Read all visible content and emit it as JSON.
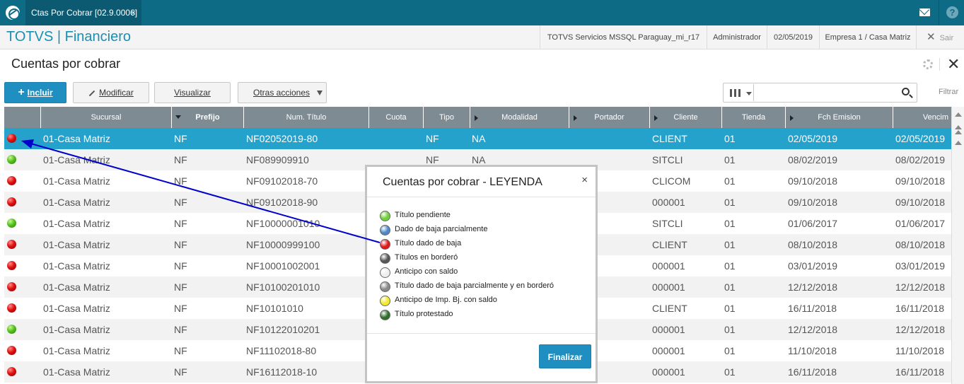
{
  "tab": {
    "title": "Ctas Por Cobrar [02.9.0006]",
    "close": "×"
  },
  "app": {
    "title": "TOTVS | Financiero",
    "server": "TOTVS Servicios MSSQL Paraguay_mi_r17",
    "user": "Administrador",
    "date": "02/05/2019",
    "company": "Empresa 1 / Casa Matriz",
    "exit": "Sair"
  },
  "page": {
    "title": "Cuentas por cobrar"
  },
  "toolbar": {
    "incluir": "Incluir",
    "modificar": "Modificar",
    "visualizar": "Visualizar",
    "otras": "Otras acciones",
    "search_placeholder": "",
    "filtrar": "Filtrar"
  },
  "grid": {
    "headers": [
      "Sucursal",
      "Prefijo",
      "Num. Título",
      "Cuota",
      "Tipo",
      "Modalidad",
      "Portador",
      "Cliente",
      "Tienda",
      "Fch Emision",
      "Vencim"
    ],
    "rows": [
      {
        "status": "red",
        "sucursal": "01-Casa Matriz",
        "prefijo": "NF",
        "num": "NF02052019-80",
        "tipo": "NF",
        "modalidad": "NA",
        "cliente": "CLIENT",
        "tienda": "01",
        "emision": "02/05/2019",
        "venc": "02/05/2019"
      },
      {
        "status": "green",
        "sucursal": "01-Casa Matriz",
        "prefijo": "NF",
        "num": "NF089909910",
        "tipo": "NF",
        "modalidad": "NA",
        "cliente": "SITCLI",
        "tienda": "01",
        "emision": "08/02/2019",
        "venc": "08/02/2019"
      },
      {
        "status": "red",
        "sucursal": "01-Casa Matriz",
        "prefijo": "NF",
        "num": "NF09102018-70",
        "tipo": "",
        "modalidad": "",
        "cliente": "CLICOM",
        "tienda": "01",
        "emision": "09/10/2018",
        "venc": "09/10/2018"
      },
      {
        "status": "red",
        "sucursal": "01-Casa Matriz",
        "prefijo": "NF",
        "num": "NF09102018-90",
        "tipo": "",
        "modalidad": "",
        "cliente": "000001",
        "tienda": "01",
        "emision": "09/10/2018",
        "venc": "09/10/2018"
      },
      {
        "status": "green",
        "sucursal": "01-Casa Matriz",
        "prefijo": "NF",
        "num": "NF10000001010",
        "tipo": "",
        "modalidad": "",
        "cliente": "SITCLI",
        "tienda": "01",
        "emision": "01/06/2017",
        "venc": "01/06/2017"
      },
      {
        "status": "red",
        "sucursal": "01-Casa Matriz",
        "prefijo": "NF",
        "num": "NF10000999100",
        "tipo": "",
        "modalidad": "",
        "cliente": "CLIENT",
        "tienda": "01",
        "emision": "08/10/2018",
        "venc": "08/10/2018"
      },
      {
        "status": "red",
        "sucursal": "01-Casa Matriz",
        "prefijo": "NF",
        "num": "NF10001002001",
        "tipo": "",
        "modalidad": "",
        "cliente": "000001",
        "tienda": "01",
        "emision": "03/01/2019",
        "venc": "03/01/2019"
      },
      {
        "status": "red",
        "sucursal": "01-Casa Matriz",
        "prefijo": "NF",
        "num": "NF10100201010",
        "tipo": "",
        "modalidad": "",
        "cliente": "000001",
        "tienda": "01",
        "emision": "12/12/2018",
        "venc": "12/12/2018"
      },
      {
        "status": "red",
        "sucursal": "01-Casa Matriz",
        "prefijo": "NF",
        "num": "NF10101010",
        "tipo": "",
        "modalidad": "",
        "cliente": "CLIENT",
        "tienda": "01",
        "emision": "16/11/2018",
        "venc": "16/11/2018"
      },
      {
        "status": "green",
        "sucursal": "01-Casa Matriz",
        "prefijo": "NF",
        "num": "NF10122010201",
        "tipo": "",
        "modalidad": "",
        "cliente": "000001",
        "tienda": "01",
        "emision": "12/12/2018",
        "venc": "12/12/2018"
      },
      {
        "status": "red",
        "sucursal": "01-Casa Matriz",
        "prefijo": "NF",
        "num": "NF11102018-80",
        "tipo": "",
        "modalidad": "",
        "cliente": "000001",
        "tienda": "01",
        "emision": "11/10/2018",
        "venc": "11/10/2018"
      },
      {
        "status": "red",
        "sucursal": "01-Casa Matriz",
        "prefijo": "NF",
        "num": "NF16112018-10",
        "tipo": "",
        "modalidad": "",
        "cliente": "000001",
        "tienda": "01",
        "emision": "16/11/2018",
        "venc": "16/11/2018"
      }
    ]
  },
  "legend": {
    "title": "Cuentas por cobrar - LEYENDA",
    "close": "×",
    "items": [
      {
        "label": "Título pendiente",
        "color": "#6fd13a"
      },
      {
        "label": "Dado de baja parcialmente",
        "color": "#4f86c6"
      },
      {
        "label": "Título dado de baja",
        "color": "#e01818"
      },
      {
        "label": "Títulos en borderó",
        "color": "#555555"
      },
      {
        "label": "Anticipo con saldo",
        "color": "#eeeeee"
      },
      {
        "label": "Título dado de baja parcialmente y en borderó",
        "color": "#888888"
      },
      {
        "label": "Anticipo de Imp. Bj. con saldo",
        "color": "#f2ea2a"
      },
      {
        "label": "Título protestado",
        "color": "#2f6e2a"
      }
    ],
    "finalizar": "Finalizar"
  },
  "colors": {
    "topbar": "#0e6b86",
    "accent": "#1e8fc0",
    "selected_row": "#25a2cc",
    "annotation_arrow": "#0000cc"
  }
}
